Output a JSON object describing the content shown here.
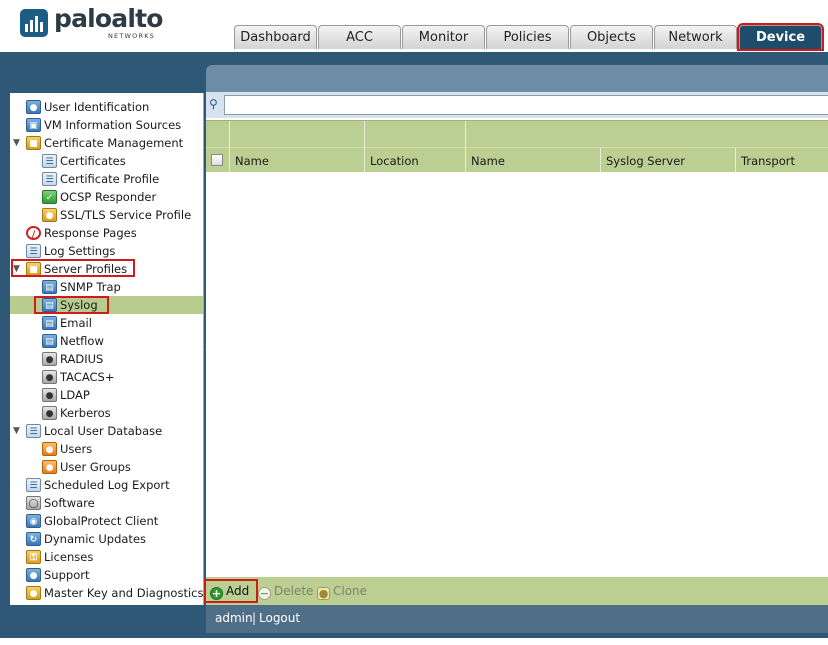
{
  "brand": {
    "name": "paloalto",
    "sub": "NETWORKS"
  },
  "tabs": [
    {
      "label": "Dashboard"
    },
    {
      "label": "ACC"
    },
    {
      "label": "Monitor"
    },
    {
      "label": "Policies"
    },
    {
      "label": "Objects"
    },
    {
      "label": "Network"
    },
    {
      "label": "Device",
      "active": true
    }
  ],
  "sidebar": {
    "items": [
      {
        "label": "User Identification",
        "icon": "user-identification-icon"
      },
      {
        "label": "VM Information Sources",
        "icon": "vm-monitor-icon"
      },
      {
        "label": "Certificate Management",
        "icon": "certificate-folder-icon",
        "expanded": true
      },
      {
        "label": "Certificates",
        "icon": "certificate-icon"
      },
      {
        "label": "Certificate Profile",
        "icon": "certificate-profile-icon"
      },
      {
        "label": "OCSP Responder",
        "icon": "ocsp-responder-icon"
      },
      {
        "label": "SSL/TLS Service Profile",
        "icon": "lock-icon"
      },
      {
        "label": "Response Pages",
        "icon": "no-entry-icon"
      },
      {
        "label": "Log Settings",
        "icon": "log-settings-icon"
      },
      {
        "label": "Server Profiles",
        "icon": "server-profiles-icon",
        "expanded": true
      },
      {
        "label": "SNMP Trap",
        "icon": "snmp-trap-icon"
      },
      {
        "label": "Syslog",
        "icon": "syslog-icon",
        "selected": true
      },
      {
        "label": "Email",
        "icon": "email-icon"
      },
      {
        "label": "Netflow",
        "icon": "netflow-icon"
      },
      {
        "label": "RADIUS",
        "icon": "radius-icon"
      },
      {
        "label": "TACACS+",
        "icon": "tacacs-icon"
      },
      {
        "label": "LDAP",
        "icon": "ldap-icon"
      },
      {
        "label": "Kerberos",
        "icon": "kerberos-icon"
      },
      {
        "label": "Local User Database",
        "icon": "local-user-database-icon",
        "expanded": true
      },
      {
        "label": "Users",
        "icon": "user-icon"
      },
      {
        "label": "User Groups",
        "icon": "user-group-icon"
      },
      {
        "label": "Scheduled Log Export",
        "icon": "scheduled-export-icon"
      },
      {
        "label": "Software",
        "icon": "software-icon"
      },
      {
        "label": "GlobalProtect Client",
        "icon": "globalprotect-icon"
      },
      {
        "label": "Dynamic Updates",
        "icon": "dynamic-updates-icon"
      },
      {
        "label": "Licenses",
        "icon": "key-icon"
      },
      {
        "label": "Support",
        "icon": "support-icon"
      },
      {
        "label": "Master Key and Diagnostics",
        "icon": "master-key-lock-icon"
      }
    ]
  },
  "grid": {
    "columns": [
      "Name",
      "Location",
      "Name",
      "Syslog Server",
      "Transport"
    ],
    "rows": []
  },
  "actions": {
    "add": "Add",
    "delete": "Delete",
    "clone": "Clone"
  },
  "footer": {
    "user": "admin",
    "separator": "|",
    "logout": "Logout"
  },
  "colors": {
    "highlight": "#d11a1a",
    "header_blue": "#2f5876",
    "grid_green": "#bccf93",
    "active_tab": "#1e4d6c"
  }
}
